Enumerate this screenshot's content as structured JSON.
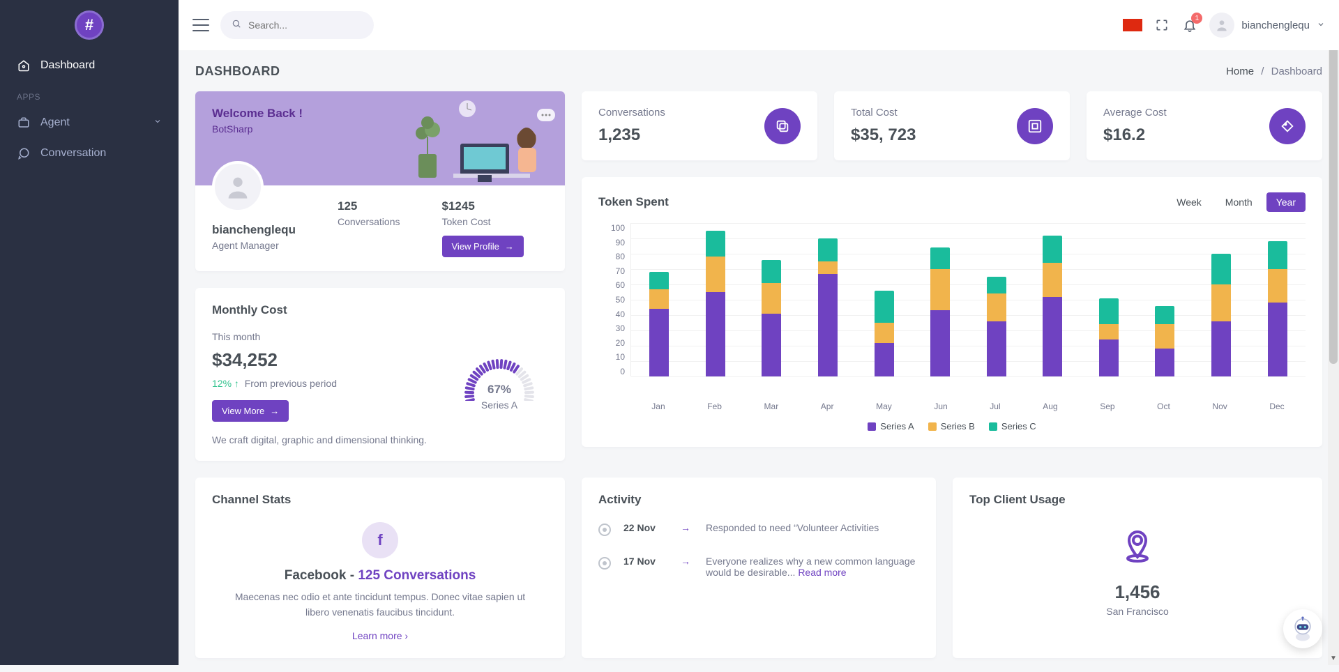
{
  "sidebar": {
    "items": [
      {
        "label": "Dashboard",
        "active": true
      },
      {
        "label": "Agent"
      },
      {
        "label": "Conversation"
      }
    ],
    "section": "APPS"
  },
  "header": {
    "search_placeholder": "Search...",
    "notif_count": "1",
    "username": "bianchenglequ"
  },
  "page": {
    "title": "DASHBOARD",
    "crumb_home": "Home",
    "crumb_current": "Dashboard"
  },
  "welcome": {
    "title": "Welcome Back !",
    "subtitle": "BotSharp",
    "username": "bianchenglequ",
    "role": "Agent Manager",
    "stat1_value": "125",
    "stat1_label": "Conversations",
    "stat2_value": "$1245",
    "stat2_label": "Token Cost",
    "button": "View Profile"
  },
  "monthly": {
    "title": "Monthly Cost",
    "period": "This month",
    "value": "$34,252",
    "pct": "12%",
    "pct_icon": "↑",
    "pct_caption": "From previous period",
    "button": "View More",
    "gauge_pct": "67%",
    "gauge_label": "Series A",
    "note": "We craft digital, graphic and dimensional thinking."
  },
  "stats": [
    {
      "label": "Conversations",
      "value": "1,235"
    },
    {
      "label": "Total Cost",
      "value": "$35, 723"
    },
    {
      "label": "Average Cost",
      "value": "$16.2"
    }
  ],
  "chart": {
    "title": "Token Spent",
    "tabs": [
      "Week",
      "Month",
      "Year"
    ],
    "active_tab": "Year",
    "legend": [
      "Series A",
      "Series B",
      "Series C"
    ]
  },
  "chart_data": {
    "type": "bar-stacked",
    "categories": [
      "Jan",
      "Feb",
      "Mar",
      "Apr",
      "May",
      "Jun",
      "Jul",
      "Aug",
      "Sep",
      "Oct",
      "Nov",
      "Dec"
    ],
    "series": [
      {
        "name": "Series A",
        "values": [
          44,
          55,
          41,
          67,
          22,
          43,
          36,
          52,
          24,
          18,
          36,
          48
        ]
      },
      {
        "name": "Series B",
        "values": [
          13,
          23,
          20,
          8,
          13,
          27,
          18,
          22,
          10,
          16,
          24,
          22
        ]
      },
      {
        "name": "Series C",
        "values": [
          11,
          17,
          15,
          15,
          21,
          14,
          11,
          18,
          17,
          12,
          20,
          18
        ]
      }
    ],
    "ylim": [
      0,
      100
    ],
    "yticks": [
      0,
      10,
      20,
      30,
      40,
      50,
      60,
      70,
      80,
      90,
      100
    ],
    "title": "Token Spent",
    "xlabel": "",
    "ylabel": ""
  },
  "channel": {
    "title": "Channel Stats",
    "name": "Facebook",
    "sep": " - ",
    "count": "125 Conversations",
    "desc": "Maecenas nec odio et ante tincidunt tempus. Donec vitae sapien ut libero venenatis faucibus tincidunt.",
    "more": "Learn more"
  },
  "activity": {
    "title": "Activity",
    "items": [
      {
        "date": "22 Nov",
        "text": "Responded to need “Volunteer Activities",
        "link": ""
      },
      {
        "date": "17 Nov",
        "text": "Everyone realizes why a new common language would be desirable... ",
        "link": "Read more"
      }
    ]
  },
  "topclient": {
    "title": "Top Client Usage",
    "value": "1,456",
    "city": "San Francisco"
  }
}
